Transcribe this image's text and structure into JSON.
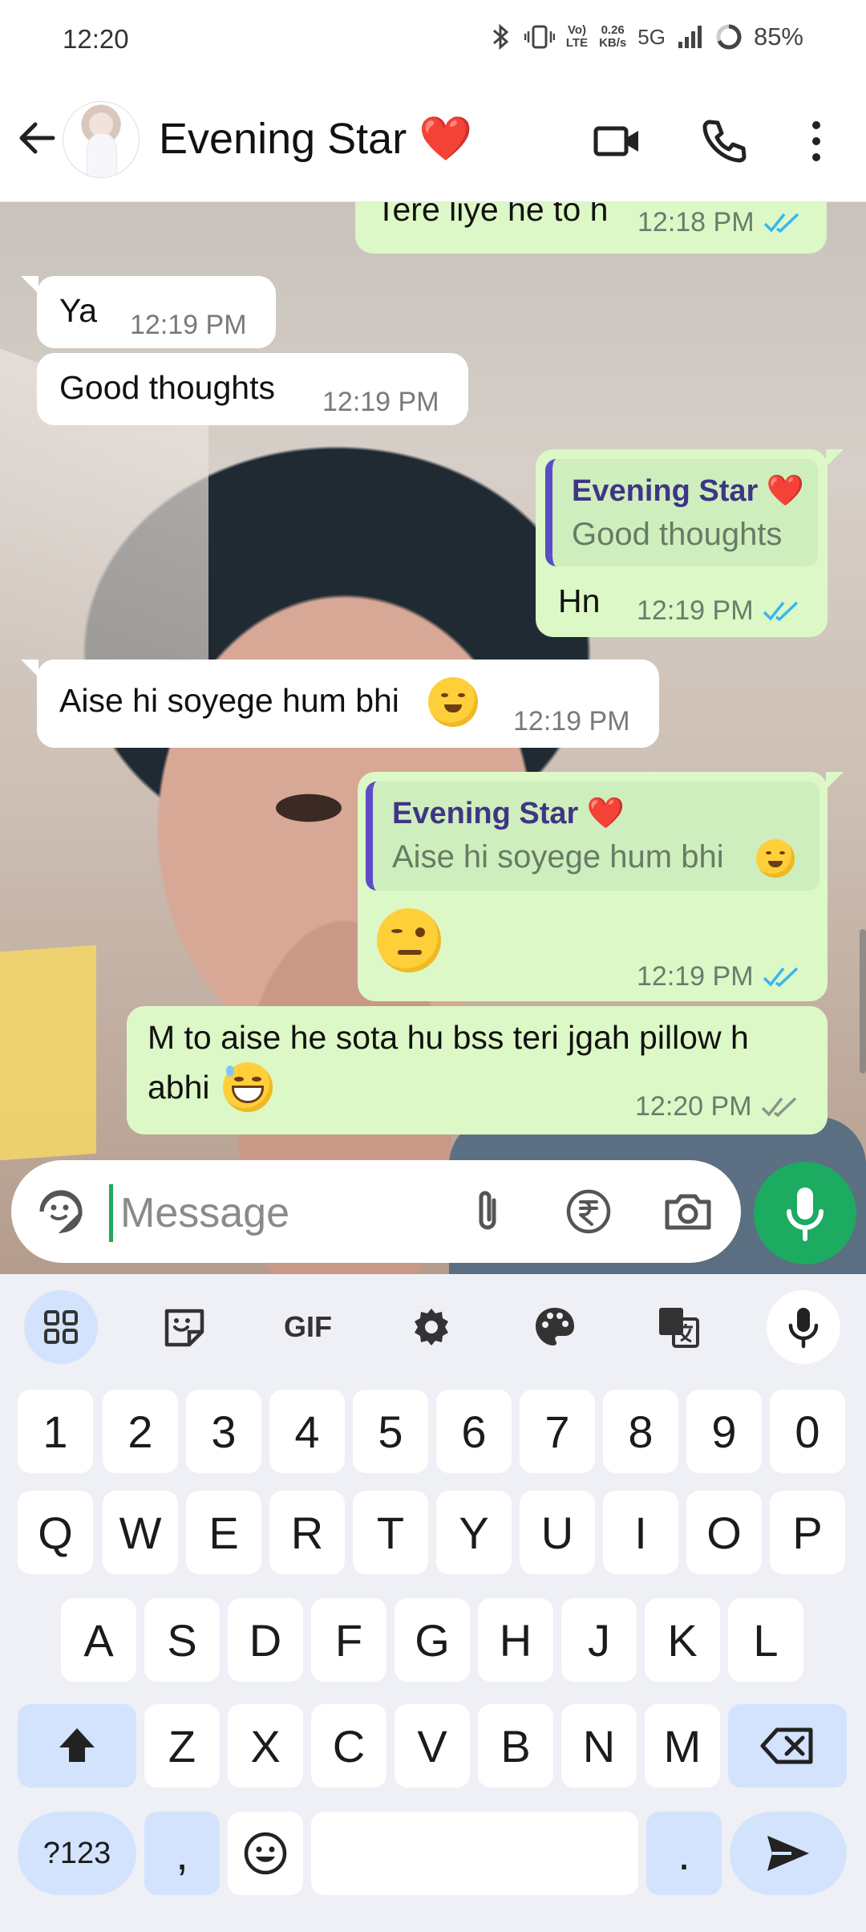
{
  "status": {
    "time": "12:20",
    "net_speed_top": "0.26",
    "net_speed_bottom": "KB/s",
    "volte_top": "Vo)",
    "volte_bottom": "LTE",
    "network": "5G",
    "battery": "85%"
  },
  "header": {
    "contact_name": "Evening Star ❤️"
  },
  "messages": [
    {
      "id": "m1",
      "dir": "out",
      "text": "Tere liye he to h",
      "time": "12:18 PM",
      "status": "read"
    },
    {
      "id": "m2",
      "dir": "in",
      "text": "Ya",
      "time": "12:19 PM"
    },
    {
      "id": "m3",
      "dir": "in",
      "text": "Good thoughts",
      "time": "12:19 PM"
    },
    {
      "id": "m4",
      "dir": "out",
      "quote_author": "Evening Star ❤️",
      "quote_text": "Good thoughts",
      "text": "Hn",
      "time": "12:19 PM",
      "status": "read"
    },
    {
      "id": "m5",
      "dir": "in",
      "text": "Aise hi soyege hum bhi",
      "emoji": "hugging-face",
      "time": "12:19 PM"
    },
    {
      "id": "m6",
      "dir": "out",
      "quote_author": "Evening Star ❤️",
      "quote_text": "Aise hi soyege hum bhi",
      "quote_emoji": "hugging-face",
      "emoji": "smirking-wink",
      "time": "12:19 PM",
      "status": "read"
    },
    {
      "id": "m7",
      "dir": "out",
      "text_line1": "M to aise he sota hu bss teri jgah pillow h",
      "text_line2": "abhi",
      "emoji": "grinning-sweat",
      "time": "12:20 PM",
      "status": "delivered"
    }
  ],
  "input": {
    "placeholder": "Message"
  },
  "keyboard": {
    "tools": [
      "apps-grid-icon",
      "sticker-icon",
      "GIF",
      "settings-icon",
      "palette-icon",
      "translate-icon",
      "mic-icon"
    ],
    "gif_label": "GIF",
    "row_numbers": [
      "1",
      "2",
      "3",
      "4",
      "5",
      "6",
      "7",
      "8",
      "9",
      "0"
    ],
    "row1": [
      "Q",
      "W",
      "E",
      "R",
      "T",
      "Y",
      "U",
      "I",
      "O",
      "P"
    ],
    "row2": [
      "A",
      "S",
      "D",
      "F",
      "G",
      "H",
      "J",
      "K",
      "L"
    ],
    "row3": [
      "Z",
      "X",
      "C",
      "V",
      "B",
      "N",
      "M"
    ],
    "symbols_key": "?123",
    "comma_key": ",",
    "period_key": "."
  },
  "colors": {
    "accent_green": "#1daa61",
    "bubble_out": "#dcf8c6",
    "read_tick": "#34b7f1",
    "quote_bar": "#5b4dc7"
  }
}
